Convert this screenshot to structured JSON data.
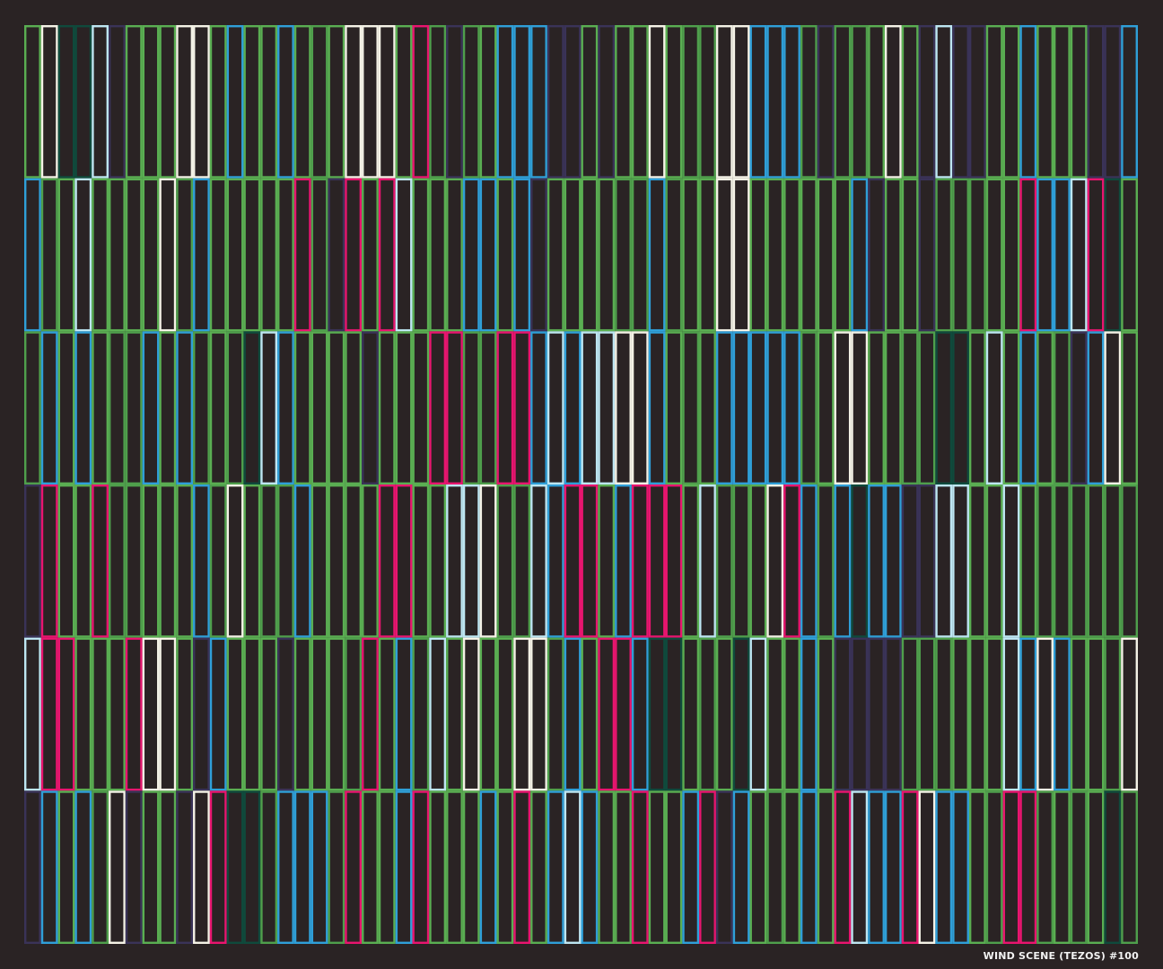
{
  "artwork": {
    "caption": "WIND SCENE (TEZOS) #100",
    "background_color": "#2a2324",
    "palette": [
      "#5aae52",
      "#4f9f4c",
      "#2f9fd8",
      "#e8156f",
      "#f4f2e6",
      "#bde6f2",
      "#3a3358",
      "#0f4a3c"
    ],
    "palette_weights": [
      8,
      4,
      4,
      2,
      2,
      1.5,
      2,
      1
    ],
    "rows": 6,
    "columns": 66,
    "pattern_seed": 100
  }
}
